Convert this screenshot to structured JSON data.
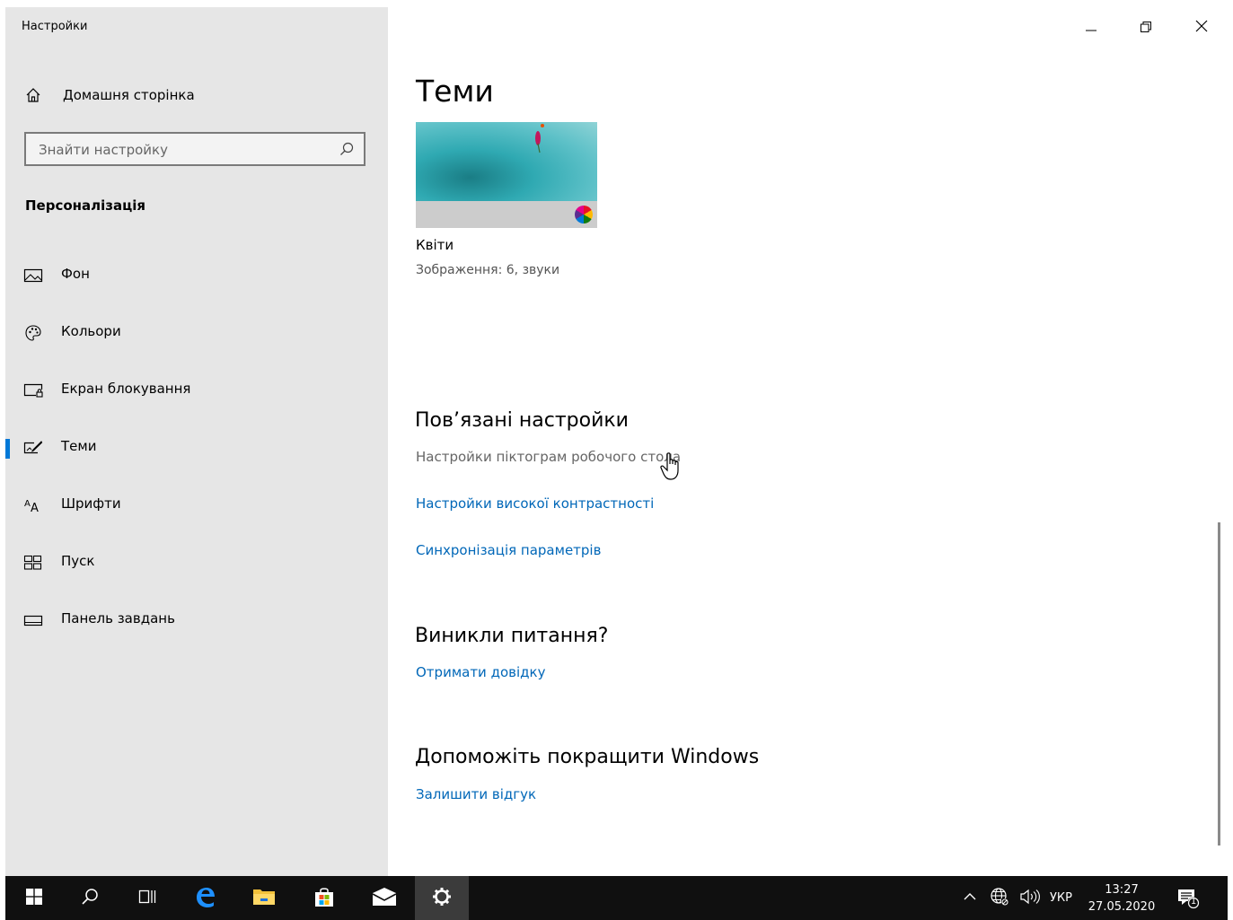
{
  "window": {
    "title": "Настройки",
    "controls": {
      "minimize": "minimize-icon",
      "maximize": "restore-icon",
      "close": "close-icon"
    }
  },
  "sidebar": {
    "home_label": "Домашня сторінка",
    "search_placeholder": "Знайти настройку",
    "section_title": "Персоналізація",
    "items": [
      {
        "label": "Фон",
        "icon": "picture-icon",
        "active": false
      },
      {
        "label": "Кольори",
        "icon": "palette-icon",
        "active": false
      },
      {
        "label": "Екран блокування",
        "icon": "lock-screen-icon",
        "active": false
      },
      {
        "label": "Теми",
        "icon": "themes-icon",
        "active": true
      },
      {
        "label": "Шрифти",
        "icon": "fonts-icon",
        "active": false
      },
      {
        "label": "Пуск",
        "icon": "start-icon",
        "active": false
      },
      {
        "label": "Панель завдань",
        "icon": "taskbar-icon",
        "active": false
      }
    ]
  },
  "main": {
    "title": "Теми",
    "theme": {
      "name": "Квіти",
      "description": "Зображення: 6, звуки"
    },
    "related": {
      "heading": "Пов’язані настройки",
      "desktop_icons": "Настройки піктограм робочого стола",
      "high_contrast": "Настройки високої контрастності",
      "sync": "Синхронізація параметрів"
    },
    "help": {
      "heading": "Виникли питання?",
      "link": "Отримати довідку"
    },
    "feedback": {
      "heading": "Допоможіть покращити Windows",
      "link": "Залишити відгук"
    }
  },
  "taskbar": {
    "language": "УКР",
    "time": "13:27",
    "date": "27.05.2020",
    "notification_count": "1",
    "accent": "#0078d7"
  }
}
